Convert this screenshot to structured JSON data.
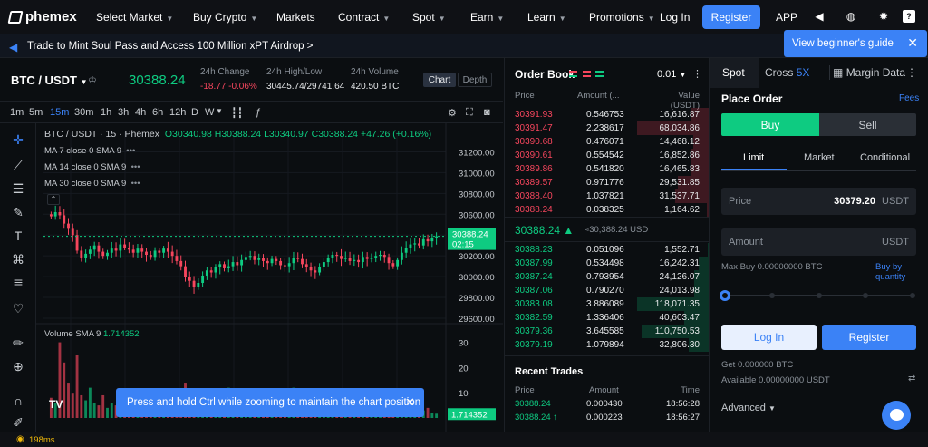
{
  "nav": {
    "logo": "phemex",
    "items": [
      {
        "label": "Select Market",
        "dropdown": true
      },
      {
        "label": "Buy Crypto",
        "dropdown": true
      },
      {
        "label": "Markets",
        "dropdown": false
      },
      {
        "label": "Contract",
        "dropdown": true
      },
      {
        "label": "Spot",
        "dropdown": true
      },
      {
        "label": "Earn",
        "dropdown": true
      },
      {
        "label": "Learn",
        "dropdown": true
      },
      {
        "label": "Promotions",
        "dropdown": true
      }
    ],
    "login": "Log In",
    "register": "Register",
    "app": "APP"
  },
  "banner": {
    "text": "Trade to Mint Soul Pass and Access 100 Million xPT Airdrop  >"
  },
  "guide": {
    "text": "View beginner's guide"
  },
  "ticker": {
    "pair": "BTC / USDT",
    "price": "30388.24",
    "change_label": "24h Change",
    "change_val": "-18.77",
    "change_pct": "-0.06%",
    "hl_label": "24h High/Low",
    "hl_val": "30445.74/29741.64",
    "vol_label": "24h Volume",
    "vol_val": "420.50 BTC",
    "chart_btn": "Chart",
    "depth_btn": "Depth"
  },
  "timeframes": [
    "1m",
    "5m",
    "15m",
    "30m",
    "1h",
    "3h",
    "4h",
    "6h",
    "12h",
    "D",
    "W"
  ],
  "active_tf": "15m",
  "chart": {
    "symbol": "BTC / USDT · 15 · Phemex",
    "o": "O30340.98",
    "h": "H30388.24",
    "l": "L30340.97",
    "c": "C30388.24",
    "chg": "+47.26 (+0.16%)",
    "ma": [
      "MA 7 close 0 SMA 9",
      "MA 14 close 0 SMA 9",
      "MA 30 close 0 SMA 9"
    ],
    "price_ticks": [
      "31200.00",
      "31000.00",
      "30800.00",
      "30600.00",
      "30400.00",
      "30200.00",
      "30000.00",
      "29800.00",
      "29600.00"
    ],
    "last_label": "30388.24",
    "countdown": "02:15",
    "volume_label": "Volume SMA 9",
    "volume_val": "1.714352",
    "vol_ticks": [
      "30",
      "20",
      "10"
    ],
    "vol_last": "1.714352"
  },
  "chart_data": {
    "type": "candlestick",
    "ylim": [
      29600,
      31300
    ],
    "closes": [
      30580,
      30620,
      30590,
      30510,
      30460,
      30400,
      30250,
      30180,
      30220,
      30260,
      30300,
      30240,
      30200,
      30230,
      30270,
      30250,
      30310,
      30280,
      30260,
      30230,
      30270,
      30240,
      30210,
      30190,
      30250,
      30230,
      30270,
      30240,
      30200,
      30150,
      30100,
      30000,
      29960,
      29900,
      29940,
      30010,
      30060,
      30040,
      30090,
      30120,
      30080,
      30100,
      30140,
      30110,
      30160,
      30190,
      30200,
      30160,
      30180,
      30150,
      30130,
      30170,
      30150,
      30110,
      30100,
      30130,
      30180,
      30170,
      30120,
      30090,
      30060,
      30040,
      30090,
      30140,
      30180,
      30210,
      30200,
      30170,
      30180,
      30150,
      30160,
      30140,
      30190,
      30170,
      30180,
      30200,
      30210,
      30190,
      30130,
      30100,
      30160,
      30230,
      30280,
      30310,
      30320,
      30300,
      30360,
      30340,
      30370,
      30388
    ],
    "volumes": [
      8,
      6,
      30,
      22,
      14,
      10,
      25,
      9,
      7,
      12,
      6,
      5,
      9,
      4,
      6,
      5,
      8,
      6,
      4,
      5,
      6,
      3,
      4,
      6,
      5,
      4,
      3,
      5,
      4,
      7,
      10,
      14,
      9,
      6,
      5,
      4,
      7,
      6,
      5,
      4,
      3,
      12,
      5,
      4,
      3,
      6,
      4,
      5,
      3,
      4,
      5,
      3,
      4,
      5,
      2,
      3,
      12,
      4,
      3,
      6,
      5,
      4,
      3,
      4,
      5,
      6,
      4,
      3,
      5,
      4,
      3,
      2,
      4,
      3,
      5,
      4,
      3,
      2,
      4,
      3,
      5,
      11,
      4,
      3,
      5,
      4,
      3,
      4,
      2,
      1.7
    ]
  },
  "orderbook": {
    "title": "Order Book",
    "precision": "0.01",
    "headers": [
      "Price",
      "Amount (...",
      "Value (USDT)"
    ],
    "asks": [
      [
        "30391.93",
        "0.546753",
        "16,616.87"
      ],
      [
        "30391.47",
        "2.238617",
        "68,034.86"
      ],
      [
        "30390.68",
        "0.476071",
        "14,468.12"
      ],
      [
        "30390.61",
        "0.554542",
        "16,852.86"
      ],
      [
        "30389.86",
        "0.541820",
        "16,465.83"
      ],
      [
        "30389.57",
        "0.971776",
        "29,531.85"
      ],
      [
        "30388.40",
        "1.037821",
        "31,537.71"
      ],
      [
        "30388.24",
        "0.038325",
        "1,164.62"
      ]
    ],
    "ask_depth": [
      0.24,
      0.99,
      0.21,
      0.25,
      0.24,
      0.43,
      0.46,
      0.02
    ],
    "mid": "30388.24",
    "mid_usd": "≈30,388.24 USD",
    "bids": [
      [
        "30388.23",
        "0.051096",
        "1,552.71"
      ],
      [
        "30387.99",
        "0.534498",
        "16,242.31"
      ],
      [
        "30387.24",
        "0.793954",
        "24,126.07"
      ],
      [
        "30387.06",
        "0.790270",
        "24,013.98"
      ],
      [
        "30383.08",
        "3.886089",
        "118,071.35"
      ],
      [
        "30382.59",
        "1.336406",
        "40,603.47"
      ],
      [
        "30379.36",
        "3.645585",
        "110,750.53"
      ],
      [
        "30379.19",
        "1.079894",
        "32,806.30"
      ]
    ],
    "bid_depth": [
      0.01,
      0.14,
      0.2,
      0.2,
      0.99,
      0.34,
      0.93,
      0.28
    ]
  },
  "recent": {
    "title": "Recent Trades",
    "headers": [
      "Price",
      "Amount",
      "Time"
    ],
    "rows": [
      [
        "30388.24",
        "0.000430",
        "18:56:28"
      ],
      [
        "30388.24 ↑",
        "0.000223",
        "18:56:27"
      ]
    ]
  },
  "trade": {
    "tabs": [
      "Spot",
      "Cross",
      "5X",
      "Margin Data"
    ],
    "place_order": "Place Order",
    "fees": "Fees",
    "buy": "Buy",
    "sell": "Sell",
    "types": [
      "Limit",
      "Market",
      "Conditional"
    ],
    "price_label": "Price",
    "price_val": "30379.20",
    "price_unit": "USDT",
    "amount_label": "Amount",
    "amount_unit": "USDT",
    "max_buy": "Max Buy 0.00000000 BTC",
    "buy_by_qty": "Buy by quantity",
    "slider_level": 0,
    "login": "Log In",
    "register": "Register",
    "get": "Get 0.000000 BTC",
    "available": "Available 0.00000000 USDT",
    "advanced": "Advanced"
  },
  "toast": {
    "text": "Press and hold Ctrl while zooming to maintain the chart position"
  },
  "status": {
    "latency": "198ms"
  },
  "colors": {
    "up": "#0ecb81",
    "down": "#f6465d",
    "accent": "#3b82f6"
  }
}
